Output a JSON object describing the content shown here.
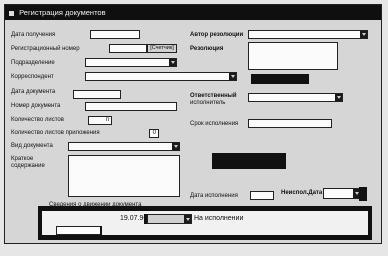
{
  "window": {
    "title": "Регистрация документов"
  },
  "form": {
    "date_received_label": "Дата получения",
    "reg_number_label": "Регистрационный номер",
    "counter_button": "[Счетчик]",
    "department_label": "Подразделение",
    "correspondent_label": "Корреспондент",
    "doc_date_label": "Дата документа",
    "doc_number_label": "Номер документа",
    "sheet_count_label": "Количество листов",
    "sheet_count_value": "п",
    "attach_count_label": "Количество листов приложения",
    "attach_count_value": "0",
    "doc_type_label": "Вид документа",
    "summary_label_1": "Краткое",
    "summary_label_2": "содержание",
    "author_resolution_label": "Автор резолюции",
    "resolution_label": "Резолюция",
    "responsible_label_1": "Ответственный",
    "responsible_label_2": "исполнитель",
    "deadline_label": "Срок исполнения",
    "exec_date_label": "Дата исполнения",
    "unexecuted_label": "Неиспол.Дата"
  },
  "execution": {
    "section_label": "Сведения о движении документа",
    "date_value": "19.07.96",
    "status_value": "На исполнении"
  },
  "colors": {
    "titlebar": "#0f0f0f",
    "field": "#fbfbfb",
    "panel": "#101010"
  }
}
